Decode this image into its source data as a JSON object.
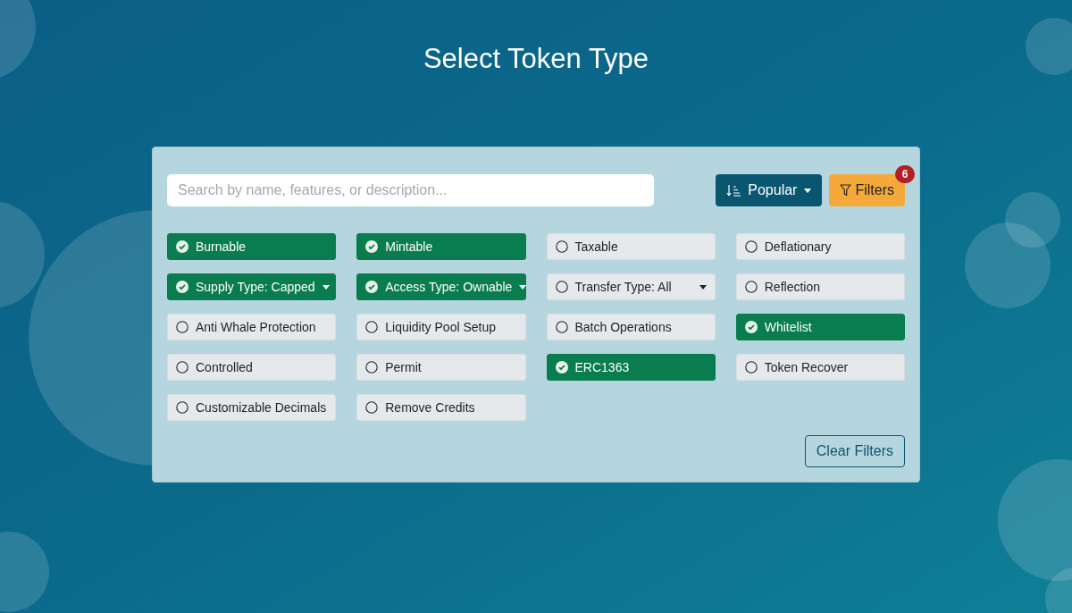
{
  "title": "Select Token Type",
  "search": {
    "placeholder": "Search by name, features, or description..."
  },
  "sort_button": {
    "label": "Popular"
  },
  "filters_button": {
    "label": "Filters",
    "badge": "6"
  },
  "options": [
    {
      "label": "Burnable",
      "selected": true,
      "kind": "toggle"
    },
    {
      "label": "Mintable",
      "selected": true,
      "kind": "toggle"
    },
    {
      "label": "Taxable",
      "selected": false,
      "kind": "toggle"
    },
    {
      "label": "Deflationary",
      "selected": false,
      "kind": "toggle"
    },
    {
      "label": "Supply Type: Capped",
      "selected": true,
      "kind": "dropdown"
    },
    {
      "label": "Access Type: Ownable",
      "selected": true,
      "kind": "dropdown"
    },
    {
      "label": "Transfer Type: All",
      "selected": false,
      "kind": "dropdown"
    },
    {
      "label": "Reflection",
      "selected": false,
      "kind": "toggle"
    },
    {
      "label": "Anti Whale Protection",
      "selected": false,
      "kind": "toggle"
    },
    {
      "label": "Liquidity Pool Setup",
      "selected": false,
      "kind": "toggle"
    },
    {
      "label": "Batch Operations",
      "selected": false,
      "kind": "toggle"
    },
    {
      "label": "Whitelist",
      "selected": true,
      "kind": "toggle"
    },
    {
      "label": "Controlled",
      "selected": false,
      "kind": "toggle"
    },
    {
      "label": "Permit",
      "selected": false,
      "kind": "toggle"
    },
    {
      "label": "ERC1363",
      "selected": true,
      "kind": "toggle"
    },
    {
      "label": "Token Recover",
      "selected": false,
      "kind": "toggle"
    },
    {
      "label": "Customizable Decimals",
      "selected": false,
      "kind": "toggle"
    },
    {
      "label": "Remove Credits",
      "selected": false,
      "kind": "toggle"
    }
  ],
  "clear_button": {
    "label": "Clear Filters"
  }
}
